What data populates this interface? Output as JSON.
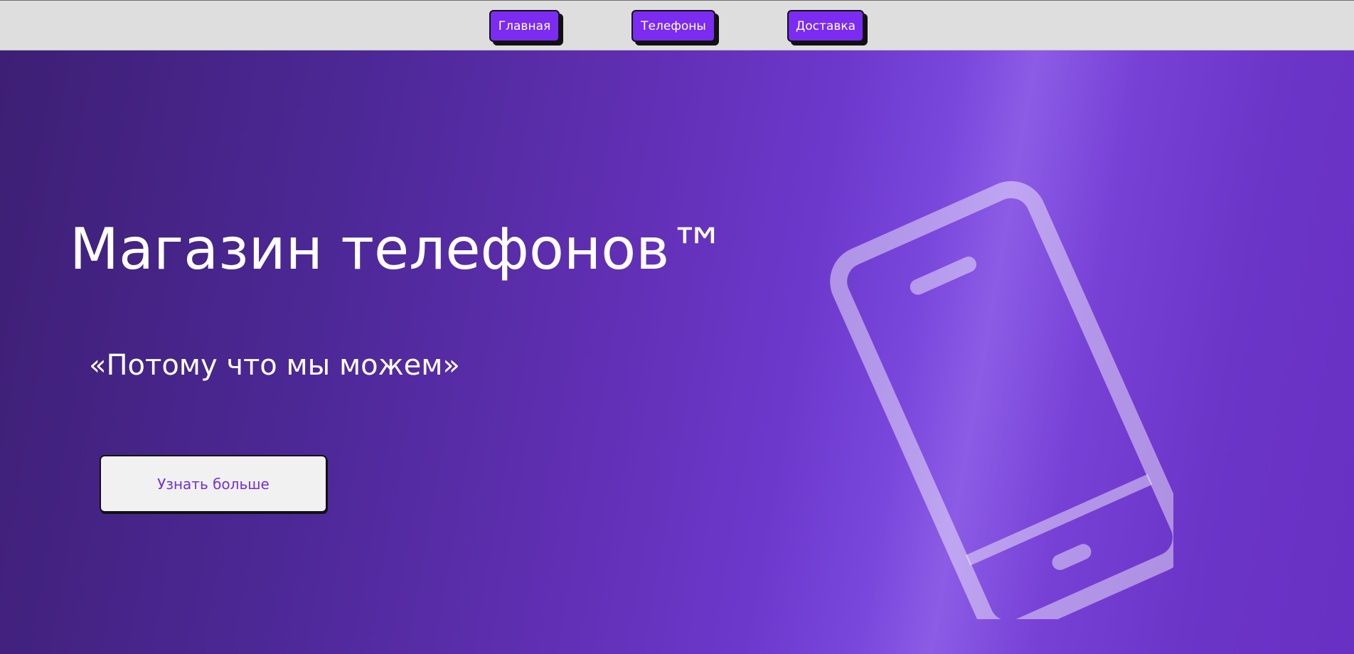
{
  "nav": {
    "items": [
      {
        "label": "Главная"
      },
      {
        "label": "Телефоны"
      },
      {
        "label": "Доставка"
      }
    ],
    "button_color": "#7b2bf2"
  },
  "hero": {
    "title": "Магазин телефонов™",
    "subtitle": "«Потому что мы можем»",
    "cta_label": "Узнать больше",
    "background_colors": [
      "#3d1f74",
      "#6c38cc",
      "#8c5ce6"
    ],
    "illustration": "smartphone-icon"
  }
}
